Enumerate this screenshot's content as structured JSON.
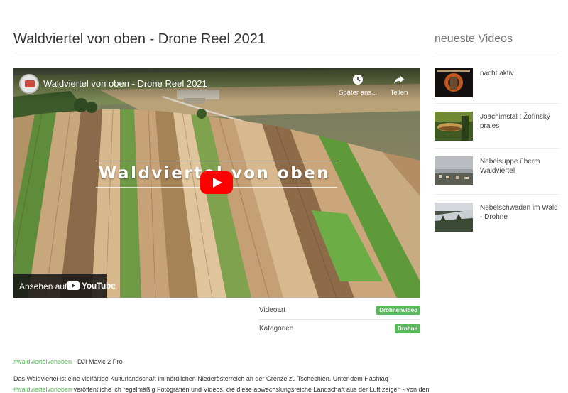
{
  "page": {
    "title": "Waldviertel von oben - Drone Reel 2021"
  },
  "video": {
    "channel_title": "Waldviertel von oben - Drone Reel 2021",
    "watch_later_label": "Später ans...",
    "share_label": "Teilen",
    "overlay_text": "Waldviertel von oben",
    "watch_on_label": "Ansehen auf",
    "youtube_wordmark": "YouTube",
    "play_color": "#ff0000"
  },
  "meta": {
    "video_type_label": "Videoart",
    "video_type_value": "Drohnenvideo",
    "categories_label": "Kategorien",
    "categories_value": "Drohne",
    "badge_color": "#5cb85c"
  },
  "description": {
    "hashtag": "#waldviertelvonoben",
    "camera": " - DJI Mavic 2 Pro",
    "line1": "Das Waldviertel ist eine vielfältige Kulturlandschaft im nördlichen Niederösterreich an der Grenze zu Tschechien. Unter dem Hashtag",
    "line2_link": "#waldviertelvonoben",
    "line2_rest": " veröffentliche ich regelmäßig Fotografien und Videos, die diese abwechslungsreiche Landschaft aus der Luft zeigen - von den"
  },
  "sidebar": {
    "title": "neueste Videos",
    "items": [
      {
        "label": "nacht.aktiv"
      },
      {
        "label": "Joachimstal : Žofínský prales"
      },
      {
        "label": "Nebelsuppe überm Waldviertel"
      },
      {
        "label": "Nebelschwaden im Wald - Drohne"
      }
    ]
  }
}
